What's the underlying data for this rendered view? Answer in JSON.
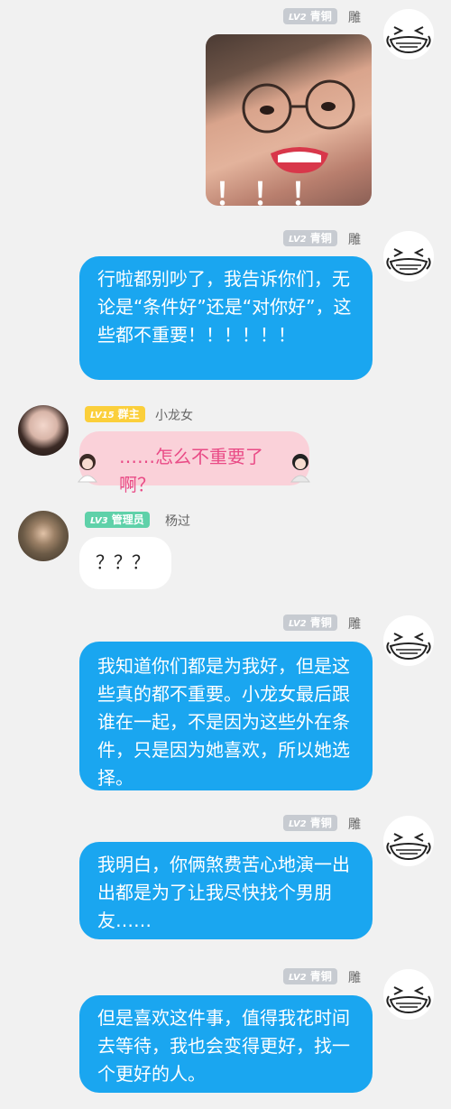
{
  "messages": [
    {
      "badge_level": "LV2",
      "badge_title": "青铜",
      "nickname": "雕",
      "image_caption": "！！！"
    },
    {
      "badge_level": "LV2",
      "badge_title": "青铜",
      "nickname": "雕",
      "text": "行啦都别吵了，我告诉你们，无论是“条件好”还是“对你好”，这些都不重要！！！！！！"
    },
    {
      "badge_level": "LV15",
      "badge_title": "群主",
      "nickname": "小龙女",
      "text": "……怎么不重要了啊？"
    },
    {
      "badge_level": "LV3",
      "badge_title": "管理员",
      "nickname": "杨过",
      "text": "？？？"
    },
    {
      "badge_level": "LV2",
      "badge_title": "青铜",
      "nickname": "雕",
      "text": "我知道你们都是为我好，但是这些真的都不重要。小龙女最后跟谁在一起，不是因为这些外在条件，只是因为她喜欢，所以她选择。"
    },
    {
      "badge_level": "LV2",
      "badge_title": "青铜",
      "nickname": "雕",
      "text": "我明白，你俩煞费苦心地演一出出都是为了让我尽快找个男朋友……"
    },
    {
      "badge_level": "LV2",
      "badge_title": "青铜",
      "nickname": "雕",
      "text": "但是喜欢这件事，值得我花时间去等待，我也会变得更好，找一个更好的人。"
    }
  ],
  "colors": {
    "background": "#f1f1f1",
    "blue_bubble": "#1aa6f0",
    "pink_bubble": "#fad1d9",
    "badge_grey": "#c7cbd1",
    "badge_yellow": "#fbcf3b",
    "badge_green": "#5fd1a9"
  }
}
